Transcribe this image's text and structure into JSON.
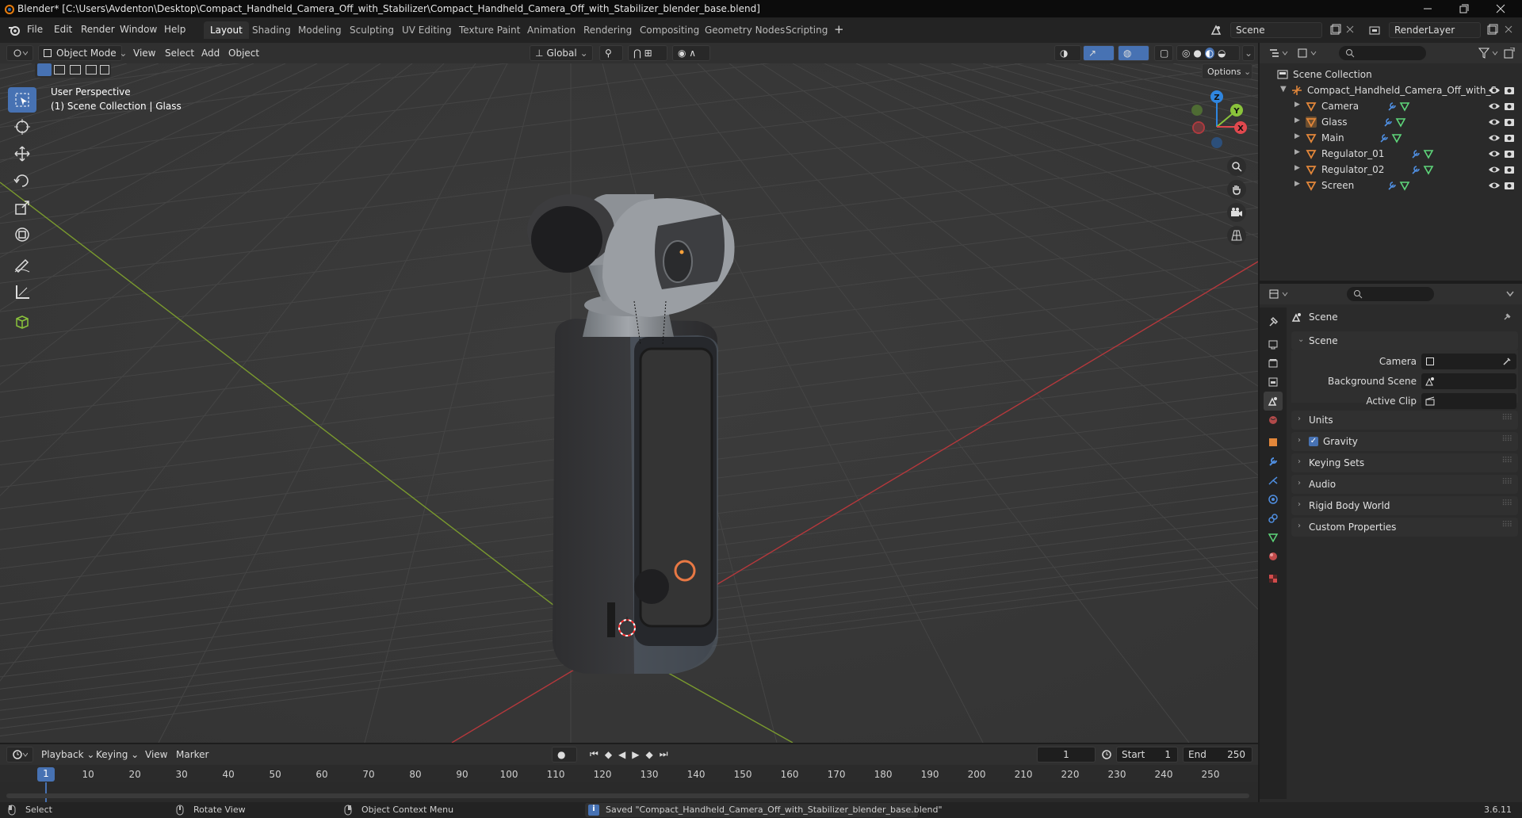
{
  "window": {
    "title": "Blender* [C:\\Users\\Avdenton\\Desktop\\Compact_Handheld_Camera_Off_with_Stabilizer\\Compact_Handheld_Camera_Off_with_Stabilizer_blender_base.blend]"
  },
  "menu": {
    "file": "File",
    "edit": "Edit",
    "render": "Render",
    "window": "Window",
    "help": "Help"
  },
  "workspaces": [
    "Layout",
    "Shading",
    "Modeling",
    "Sculpting",
    "UV Editing",
    "Texture Paint",
    "Animation",
    "Rendering",
    "Compositing",
    "Geometry Nodes",
    "Scripting"
  ],
  "scene_field": "Scene",
  "view_layer_field": "RenderLayer",
  "viewport_header": {
    "mode": "Object Mode",
    "view": "View",
    "select": "Select",
    "add": "Add",
    "object": "Object",
    "orientation": "Global",
    "options": "Options"
  },
  "viewport": {
    "perspective": "User Perspective",
    "collection_info": "(1) Scene Collection | Glass",
    "gizmo": {
      "x": "X",
      "y": "Y",
      "z": "Z"
    }
  },
  "outliner": {
    "root": "Scene Collection",
    "collection": "Compact_Handheld_Camera_Off_with_S",
    "objects": [
      "Camera",
      "Glass",
      "Main",
      "Regulator_01",
      "Regulator_02",
      "Screen"
    ]
  },
  "properties": {
    "context": "Scene",
    "scene_panel": "Scene",
    "camera_label": "Camera",
    "background_scene_label": "Background Scene",
    "active_clip_label": "Active Clip",
    "panels": [
      "Units",
      "Gravity",
      "Keying Sets",
      "Audio",
      "Rigid Body World",
      "Custom Properties"
    ],
    "gravity_enabled": true
  },
  "timeline": {
    "playback": "Playback",
    "keying": "Keying",
    "view": "View",
    "marker": "Marker",
    "current_frame": "1",
    "start_label": "Start",
    "start": "1",
    "end_label": "End",
    "end": "250",
    "ruler": [
      "10",
      "20",
      "30",
      "40",
      "50",
      "60",
      "70",
      "80",
      "90",
      "100",
      "110",
      "120",
      "130",
      "140",
      "150",
      "160",
      "170",
      "180",
      "190",
      "200",
      "210",
      "220",
      "230",
      "240",
      "250"
    ],
    "ruler_current": "1"
  },
  "statusbar": {
    "select": "Select",
    "rotate": "Rotate View",
    "context_menu": "Object Context Menu",
    "message": "Saved \"Compact_Handheld_Camera_Off_with_Stabilizer_blender_base.blend\"",
    "version": "3.6.11"
  },
  "colors": {
    "accent": "#4772b3",
    "x_axis": "#e0484e",
    "y_axis": "#8ac33b",
    "z_axis": "#2f86e0",
    "object_orange": "#e3873a"
  }
}
